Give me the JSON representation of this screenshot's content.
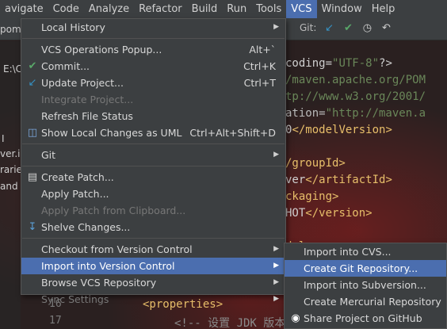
{
  "menubar": {
    "items": [
      "avigate",
      "Code",
      "Analyze",
      "Refactor",
      "Build",
      "Run",
      "Tools",
      "VCS",
      "Window",
      "Help"
    ],
    "active": "VCS"
  },
  "toolbar": {
    "git_label": "Git:"
  },
  "left_panel": {
    "texts": [
      "pom",
      "E:\\C",
      "I",
      "ver.i",
      "raries",
      "and C"
    ]
  },
  "code_lines": [
    {
      "parts": [
        {
          "c": "t-txt",
          "t": "coding="
        },
        {
          "c": "t-str",
          "t": "\"UTF-8\""
        },
        {
          "c": "t-txt",
          "t": "?>"
        }
      ]
    },
    {
      "parts": [
        {
          "c": "t-str",
          "t": "/maven.apache.org/POM"
        }
      ]
    },
    {
      "parts": [
        {
          "c": "t-str",
          "t": "tp://www.w3.org/2001/"
        }
      ]
    },
    {
      "parts": [
        {
          "c": "t-attr",
          "t": "ation="
        },
        {
          "c": "t-str",
          "t": "\"http://maven.a"
        }
      ]
    },
    {
      "parts": [
        {
          "c": "t-txt",
          "t": "0"
        },
        {
          "c": "t-tag",
          "t": "</modelVersion>"
        }
      ]
    },
    {
      "parts": [
        {
          "c": "t-txt",
          "t": ""
        }
      ]
    },
    {
      "parts": [
        {
          "c": "t-tag",
          "t": "/groupId>"
        }
      ]
    },
    {
      "parts": [
        {
          "c": "t-txt",
          "t": "ver"
        },
        {
          "c": "t-tag",
          "t": "</artifactId>"
        }
      ]
    },
    {
      "parts": [
        {
          "c": "t-tag",
          "t": "ckaging>"
        }
      ]
    },
    {
      "parts": [
        {
          "c": "t-txt",
          "t": "HOT"
        },
        {
          "c": "t-tag",
          "t": "</version>"
        }
      ]
    },
    {
      "parts": [
        {
          "c": "t-txt",
          "t": ""
        }
      ]
    },
    {
      "parts": [
        {
          "c": "t-tag",
          "t": "dule>"
        }
      ]
    }
  ],
  "bottom": {
    "line16": "16",
    "line17": "17",
    "properties": "<properties>",
    "comment": "<!-- 设置 JDK 版本"
  },
  "vcs_menu": {
    "items": [
      {
        "label": "Local History",
        "shortcut": "",
        "arrow": true,
        "disabled": false,
        "icon": ""
      },
      {
        "sep": true
      },
      {
        "label": "VCS Operations Popup...",
        "shortcut": "Alt+`",
        "disabled": false,
        "icon": ""
      },
      {
        "label": "Commit...",
        "shortcut": "Ctrl+K",
        "disabled": false,
        "icon": "check-icon"
      },
      {
        "label": "Update Project...",
        "shortcut": "Ctrl+T",
        "disabled": false,
        "icon": "update-arrow-icon"
      },
      {
        "label": "Integrate Project...",
        "shortcut": "",
        "disabled": true,
        "icon": ""
      },
      {
        "label": "Refresh File Status",
        "shortcut": "",
        "disabled": false,
        "icon": ""
      },
      {
        "label": "Show Local Changes as UML",
        "shortcut": "Ctrl+Alt+Shift+D",
        "disabled": false,
        "icon": "uml-icon"
      },
      {
        "sep": true
      },
      {
        "label": "Git",
        "shortcut": "",
        "arrow": true,
        "disabled": false,
        "icon": ""
      },
      {
        "sep": true
      },
      {
        "label": "Create Patch...",
        "shortcut": "",
        "disabled": false,
        "icon": "patch-icon"
      },
      {
        "label": "Apply Patch...",
        "shortcut": "",
        "disabled": false,
        "icon": ""
      },
      {
        "label": "Apply Patch from Clipboard...",
        "shortcut": "",
        "disabled": true,
        "icon": ""
      },
      {
        "label": "Shelve Changes...",
        "shortcut": "",
        "disabled": false,
        "icon": "shelve-icon"
      },
      {
        "sep": true
      },
      {
        "label": "Checkout from Version Control",
        "shortcut": "",
        "arrow": true,
        "disabled": false,
        "icon": ""
      },
      {
        "label": "Import into Version Control",
        "shortcut": "",
        "arrow": true,
        "disabled": false,
        "selected": true,
        "icon": ""
      },
      {
        "label": "Browse VCS Repository",
        "shortcut": "",
        "arrow": true,
        "disabled": false,
        "icon": ""
      },
      {
        "label": "Sync Settings",
        "shortcut": "",
        "arrow": true,
        "disabled": true,
        "icon": ""
      }
    ]
  },
  "sub_menu": {
    "items": [
      {
        "label": "Import into CVS...",
        "selected": false,
        "icon": ""
      },
      {
        "label": "Create Git Repository...",
        "selected": true,
        "icon": ""
      },
      {
        "label": "Import into Subversion...",
        "selected": false,
        "icon": ""
      },
      {
        "label": "Create Mercurial Repository",
        "selected": false,
        "icon": ""
      },
      {
        "label": "Share Project on GitHub",
        "selected": false,
        "icon": "github-icon"
      }
    ]
  },
  "colors": {
    "accent": "#4b6eaf",
    "menu_bg": "#3c3f41",
    "check": "#59a869",
    "update": "#3592c4"
  }
}
